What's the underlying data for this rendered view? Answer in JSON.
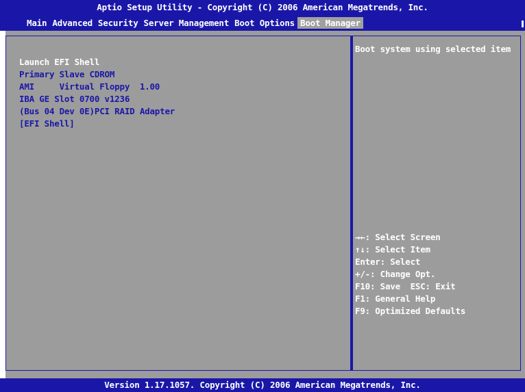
{
  "header": {
    "title": "Aptio Setup Utility - Copyright (C) 2006 American Megatrends, Inc.",
    "menu": [
      {
        "label": "Main",
        "active": false
      },
      {
        "label": "Advanced",
        "active": false
      },
      {
        "label": "Security",
        "active": false
      },
      {
        "label": "Server Management",
        "active": false
      },
      {
        "label": "Boot Options",
        "active": false
      },
      {
        "label": "Boot Manager",
        "active": true
      }
    ]
  },
  "boot_list": {
    "items": [
      {
        "label": "Launch EFI Shell",
        "selected": true
      },
      {
        "label": "Primary Slave CDROM",
        "selected": false
      },
      {
        "label": "AMI     Virtual Floppy  1.00",
        "selected": false
      },
      {
        "label": "IBA GE Slot 0700 v1236",
        "selected": false
      },
      {
        "label": "(Bus 04 Dev 0E)PCI RAID Adapter",
        "selected": false
      },
      {
        "label": "[EFI Shell]",
        "selected": false
      }
    ]
  },
  "help": {
    "text": "Boot system using selected item"
  },
  "key_legend": [
    "→←: Select Screen",
    "↑↓: Select Item",
    "Enter: Select",
    "+/-: Change Opt.",
    "F10: Save  ESC: Exit",
    "F1: General Help",
    "F9: Optimized Defaults"
  ],
  "footer": {
    "text": "Version 1.17.1057. Copyright (C) 2006 American Megatrends, Inc."
  },
  "colors": {
    "bar_blue": "#1a17a8",
    "panel_gray": "#9c9c9c",
    "highlight_gray": "#a0a0a0",
    "text_white": "#ffffff",
    "text_blue": "#1a17a8"
  }
}
